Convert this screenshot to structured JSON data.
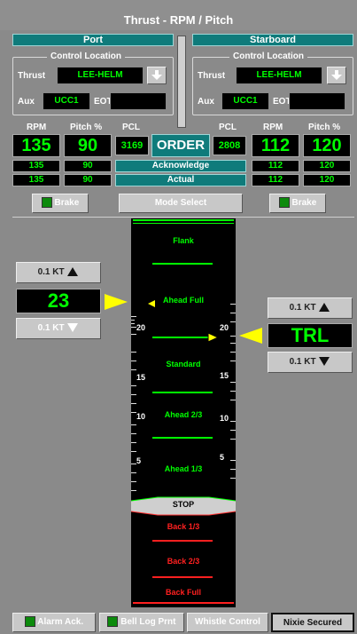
{
  "title": "Thrust - RPM / Pitch",
  "port": {
    "header": "Port",
    "control_location_label": "Control Location",
    "thrust_label": "Thrust",
    "thrust_value": "LEE-HELM",
    "aux_label": "Aux",
    "aux_value": "UCC1",
    "eot_label": "EOT",
    "eot_value": "",
    "rpm_label": "RPM",
    "pitch_label": "Pitch %",
    "pcl_label": "PCL",
    "rpm_order": "135",
    "pitch_order": "90",
    "pcl_value": "3169",
    "rpm_ack": "135",
    "pitch_ack": "90",
    "rpm_actual": "135",
    "pitch_actual": "90",
    "brake_label": "Brake"
  },
  "starboard": {
    "header": "Starboard",
    "control_location_label": "Control Location",
    "thrust_label": "Thrust",
    "thrust_value": "LEE-HELM",
    "aux_label": "Aux",
    "aux_value": "UCC1",
    "eot_label": "EOT",
    "eot_value": "",
    "rpm_label": "RPM",
    "pitch_label": "Pitch %",
    "pcl_label": "PCL",
    "rpm_order": "112",
    "pitch_order": "120",
    "pcl_value": "2808",
    "rpm_ack": "112",
    "pitch_ack": "120",
    "rpm_actual": "112",
    "pitch_actual": "120",
    "brake_label": "Brake"
  },
  "center": {
    "order_label": "ORDER",
    "acknowledge_label": "Acknowledge",
    "actual_label": "Actual",
    "mode_select_label": "Mode Select"
  },
  "left_speed": {
    "inc_label": "0.1 KT",
    "value": "23",
    "dec_label": "0.1 KT"
  },
  "right_speed": {
    "inc_label": "0.1 KT",
    "value": "TRL",
    "dec_label": "0.1 KT"
  },
  "telegraph": {
    "orders": [
      "Flank",
      "Ahead Full",
      "Standard",
      "Ahead 2/3",
      "Ahead 1/3",
      "STOP",
      "Back 1/3",
      "Back 2/3",
      "Back Full"
    ],
    "scale_left": [
      "20",
      "15",
      "10",
      "5"
    ],
    "scale_right": [
      "20",
      "15",
      "10",
      "5"
    ]
  },
  "footer": {
    "alarm_ack": "Alarm Ack.",
    "bell_log": "Bell Log Prnt",
    "whistle": "Whistle Control",
    "nixie": "Nixie Secured"
  },
  "colors": {
    "teal": "#0f7b7b",
    "green_text": "#00ff00",
    "red_text": "#ff2020",
    "yellow_pointer": "#ffff00"
  }
}
